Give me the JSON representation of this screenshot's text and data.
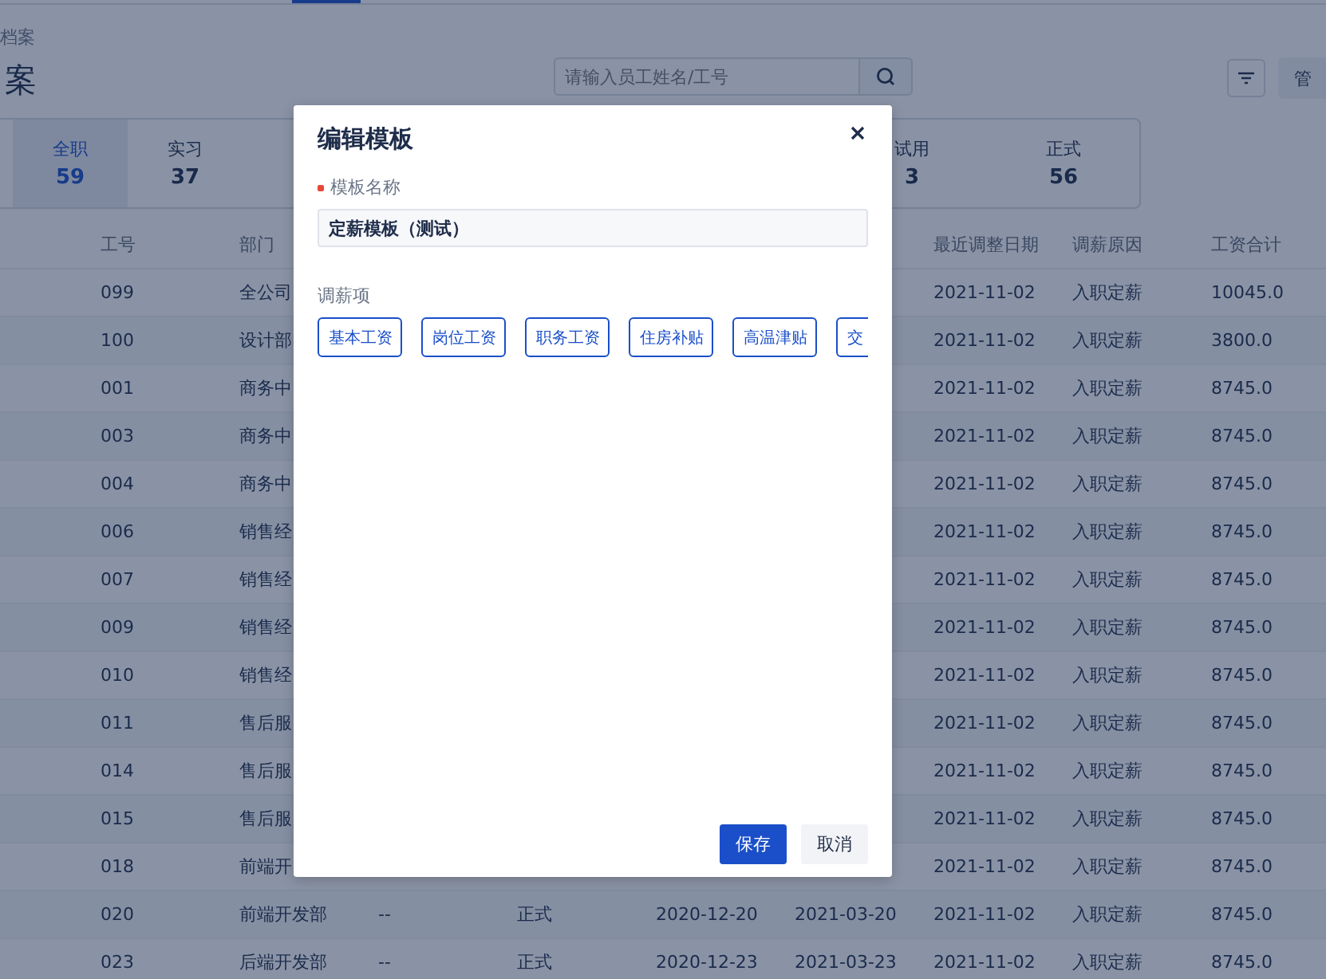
{
  "page": {
    "breadcrumb": "档案",
    "title": "案",
    "search": {
      "placeholder": "请输入员工姓名/工号"
    },
    "manage_button": "管"
  },
  "stats": [
    {
      "label": "全职",
      "value": "59",
      "selected": true
    },
    {
      "label": "实习",
      "value": "37",
      "selected": false
    },
    {
      "label": "试用",
      "value": "3",
      "selected": false,
      "kind": "right"
    },
    {
      "label": "正式",
      "value": "56",
      "selected": false,
      "kind": "right"
    }
  ],
  "table": {
    "columns": [
      "工号",
      "部门",
      null,
      null,
      null,
      null,
      "最近调整日期",
      "调薪原因",
      "工资合计"
    ],
    "rows": [
      [
        "099",
        "全公司",
        null,
        null,
        null,
        null,
        "2021-11-02",
        "入职定薪",
        "10045.0"
      ],
      [
        "100",
        "设计部",
        null,
        null,
        null,
        null,
        "2021-11-02",
        "入职定薪",
        "3800.0"
      ],
      [
        "001",
        "商务中",
        null,
        null,
        null,
        null,
        "2021-11-02",
        "入职定薪",
        "8745.0"
      ],
      [
        "003",
        "商务中",
        null,
        null,
        null,
        null,
        "2021-11-02",
        "入职定薪",
        "8745.0"
      ],
      [
        "004",
        "商务中",
        null,
        null,
        null,
        null,
        "2021-11-02",
        "入职定薪",
        "8745.0"
      ],
      [
        "006",
        "销售经",
        null,
        null,
        null,
        null,
        "2021-11-02",
        "入职定薪",
        "8745.0"
      ],
      [
        "007",
        "销售经",
        null,
        null,
        null,
        null,
        "2021-11-02",
        "入职定薪",
        "8745.0"
      ],
      [
        "009",
        "销售经",
        null,
        null,
        null,
        null,
        "2021-11-02",
        "入职定薪",
        "8745.0"
      ],
      [
        "010",
        "销售经",
        null,
        null,
        null,
        null,
        "2021-11-02",
        "入职定薪",
        "8745.0"
      ],
      [
        "011",
        "售后服",
        null,
        null,
        null,
        null,
        "2021-11-02",
        "入职定薪",
        "8745.0"
      ],
      [
        "014",
        "售后服",
        null,
        null,
        null,
        null,
        "2021-11-02",
        "入职定薪",
        "8745.0"
      ],
      [
        "015",
        "售后服",
        null,
        null,
        null,
        null,
        "2021-11-02",
        "入职定薪",
        "8745.0"
      ],
      [
        "018",
        "前端开",
        null,
        null,
        null,
        null,
        "2021-11-02",
        "入职定薪",
        "8745.0"
      ],
      [
        "020",
        "前端开发部",
        "--",
        "正式",
        "2020-12-20",
        "2021-03-20",
        "2021-11-02",
        "入职定薪",
        "8745.0"
      ],
      [
        "023",
        "后端开发部",
        "--",
        "正式",
        "2020-12-23",
        "2021-03-23",
        "2021-11-02",
        "入职定薪",
        "8745.0"
      ]
    ]
  },
  "dialog": {
    "title": "编辑模板",
    "name_field": {
      "label": "模板名称",
      "required": true,
      "value": "定薪模板（测试）"
    },
    "items_label": "调薪项",
    "items": [
      "基本工资",
      "岗位工资",
      "职务工资",
      "住房补贴",
      "高温津贴",
      "交"
    ],
    "buttons": [
      {
        "label": "保存",
        "kind": "primary"
      },
      {
        "label": "取消",
        "kind": "default"
      }
    ]
  }
}
